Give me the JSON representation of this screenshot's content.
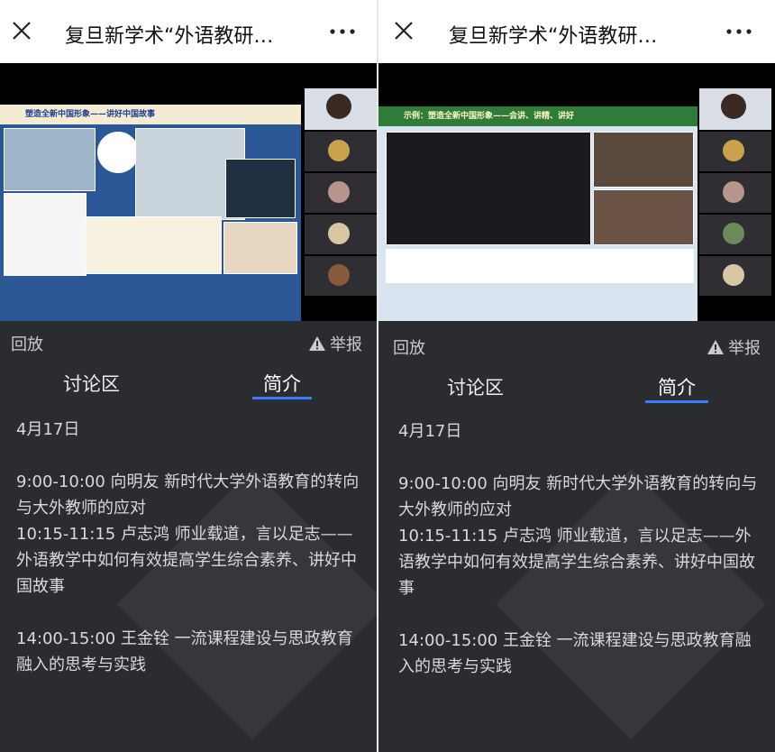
{
  "title": "复旦新学术“外语教研…",
  "replay_label": "回放",
  "report_label": "举报",
  "tabs": [
    "讨论区",
    "简介"
  ],
  "date": "4月17日",
  "schedule": [
    "9:00-10:00 向明友 新时代大学外语教育的转向与大外教师的应对",
    "10:15-11:15 卢志鸿 师业载道，言以足志——外语教学中如何有效提高学生综合素养、讲好中国故事",
    "14:00-15:00 王金铨 一流课程建设与思政教育融入的思考与实践"
  ],
  "left_slide_banner": "塑造全新中国形象——讲好中国故事",
  "right_slide_banner": "示例：塑造全新中国形象——会讲、讲精、讲好",
  "colors": {
    "accent": "#3a7cff",
    "bg": "#2b2c30"
  }
}
